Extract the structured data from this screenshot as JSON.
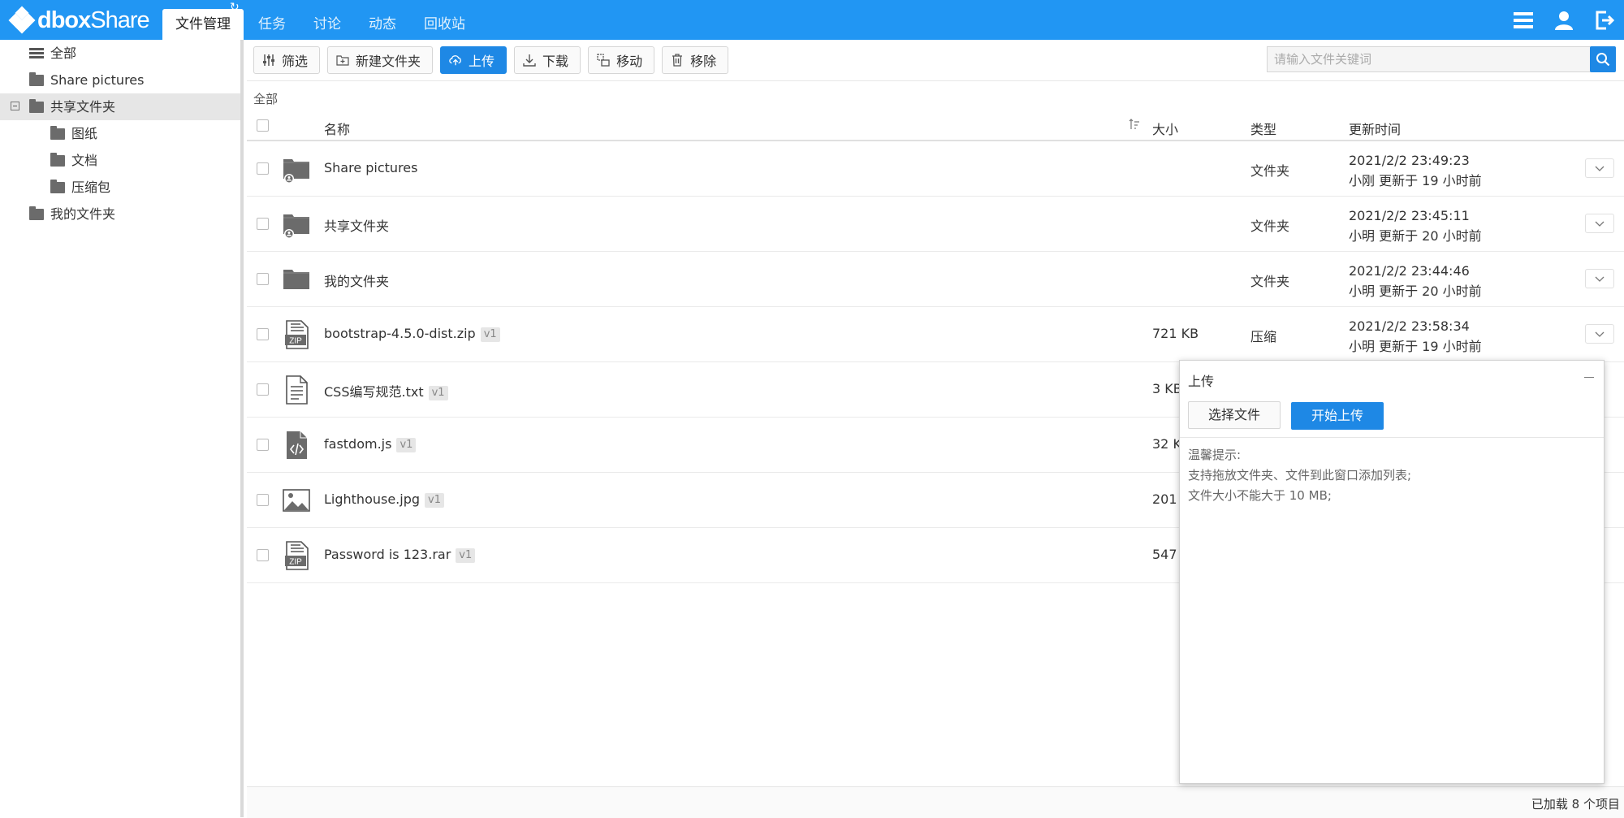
{
  "app": {
    "logo_text_bold": "dbox",
    "logo_text": "Share"
  },
  "nav": {
    "tabs": [
      {
        "label": "文件管理",
        "active": true
      },
      {
        "label": "任务"
      },
      {
        "label": "讨论"
      },
      {
        "label": "动态"
      },
      {
        "label": "回收站"
      }
    ]
  },
  "header_icons": [
    "menu-icon",
    "user-icon",
    "logout-icon"
  ],
  "sidebar": {
    "items": [
      {
        "label": "全部",
        "icon": "list-icon",
        "level": 0
      },
      {
        "label": "Share pictures",
        "icon": "folder-icon",
        "level": 0
      },
      {
        "label": "共享文件夹",
        "icon": "folder-icon",
        "level": 0,
        "expanded": true,
        "selected": true
      },
      {
        "label": "图纸",
        "icon": "folder-icon",
        "level": 1
      },
      {
        "label": "文档",
        "icon": "folder-icon",
        "level": 1
      },
      {
        "label": "压缩包",
        "icon": "folder-icon",
        "level": 1
      },
      {
        "label": "我的文件夹",
        "icon": "folder-icon",
        "level": 0
      }
    ]
  },
  "toolbar": {
    "filter": "筛选",
    "new_folder": "新建文件夹",
    "upload": "上传",
    "download": "下载",
    "move": "移动",
    "remove": "移除"
  },
  "search": {
    "placeholder": "请输入文件关键词",
    "value": ""
  },
  "breadcrumb": "全部",
  "table": {
    "headers": {
      "name": "名称",
      "size": "大小",
      "type": "类型",
      "updated": "更新时间"
    },
    "rows": [
      {
        "name": "Share pictures",
        "version": "",
        "size": "",
        "type": "文件夹",
        "time": "2021/2/2 23:49:23",
        "updater": "小刚 更新于 19 小时前",
        "icon": "shared-folder-icon"
      },
      {
        "name": "共享文件夹",
        "version": "",
        "size": "",
        "type": "文件夹",
        "time": "2021/2/2 23:45:11",
        "updater": "小明 更新于 20 小时前",
        "icon": "shared-folder-icon"
      },
      {
        "name": "我的文件夹",
        "version": "",
        "size": "",
        "type": "文件夹",
        "time": "2021/2/2 23:44:46",
        "updater": "小明 更新于 20 小时前",
        "icon": "folder-icon"
      },
      {
        "name": "bootstrap-4.5.0-dist.zip",
        "version": "v1",
        "size": "721 KB",
        "type": "压缩",
        "time": "2021/2/2 23:58:34",
        "updater": "小明 更新于 19 小时前",
        "icon": "zip-file-icon"
      },
      {
        "name": "CSS编写规范.txt",
        "version": "v1",
        "size": "3 KB",
        "type": "",
        "time": "",
        "updater": "",
        "icon": "text-file-icon"
      },
      {
        "name": "fastdom.js",
        "version": "v1",
        "size": "32 K",
        "type": "",
        "time": "",
        "updater": "",
        "icon": "code-file-icon"
      },
      {
        "name": "Lighthouse.jpg",
        "version": "v1",
        "size": "201",
        "type": "",
        "time": "",
        "updater": "",
        "icon": "image-file-icon"
      },
      {
        "name": "Password is 123.rar",
        "version": "v1",
        "size": "547",
        "type": "",
        "time": "",
        "updater": "",
        "icon": "zip-file-icon"
      }
    ]
  },
  "footer": {
    "status": "已加载 8 个项目"
  },
  "upload_panel": {
    "title": "上传",
    "choose_file": "选择文件",
    "start_upload": "开始上传",
    "tips": [
      "温馨提示:",
      "支持拖放文件夹、文件到此窗口添加列表;",
      "文件大小不能大于 10 MB;"
    ]
  },
  "colors": {
    "header": "#2196f3",
    "primary_button": "#1e88e5"
  }
}
